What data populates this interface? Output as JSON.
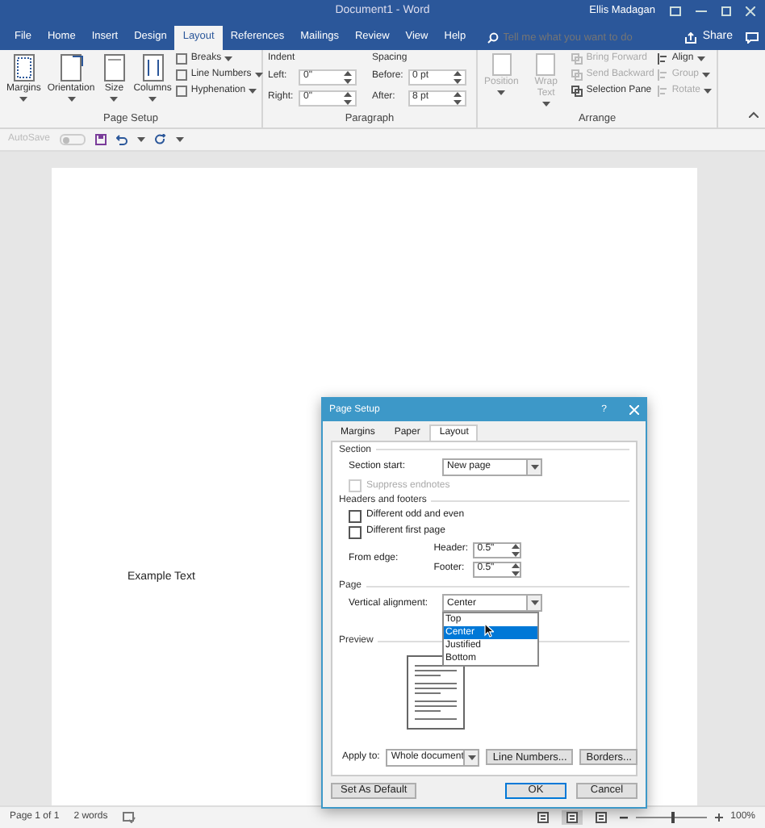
{
  "window": {
    "title": "Document1  -  Word",
    "user": "Ellis Madagan"
  },
  "tabs": [
    {
      "label": "File",
      "selected": false
    },
    {
      "label": "Home",
      "selected": false
    },
    {
      "label": "Insert",
      "selected": false
    },
    {
      "label": "Design",
      "selected": false
    },
    {
      "label": "Layout",
      "selected": true
    },
    {
      "label": "References",
      "selected": false
    },
    {
      "label": "Mailings",
      "selected": false
    },
    {
      "label": "Review",
      "selected": false
    },
    {
      "label": "View",
      "selected": false
    },
    {
      "label": "Help",
      "selected": false
    }
  ],
  "tell_me": {
    "placeholder": "Tell me what you want to do"
  },
  "share": "Share",
  "ribbon": {
    "page_setup": {
      "label": "Page Setup",
      "large_buttons": [
        {
          "label": "Margins"
        },
        {
          "label": "Orientation"
        },
        {
          "label": "Size"
        },
        {
          "label": "Columns"
        }
      ],
      "small_buttons": [
        {
          "label": "Breaks"
        },
        {
          "label": "Line Numbers"
        },
        {
          "label": "Hyphenation"
        }
      ]
    },
    "paragraph": {
      "label": "Paragraph",
      "indent_label": "Indent",
      "spacing_label": "Spacing",
      "indent": [
        {
          "label": "Left:",
          "value": "0\""
        },
        {
          "label": "Right:",
          "value": "0\""
        }
      ],
      "spacing": [
        {
          "label": "Before:",
          "value": "0 pt"
        },
        {
          "label": "After:",
          "value": "8 pt"
        }
      ]
    },
    "arrange": {
      "label": "Arrange",
      "large_buttons": [
        {
          "label": "Position",
          "disabled": true
        },
        {
          "label": "Wrap Text",
          "disabled": true
        }
      ],
      "items": [
        {
          "label": "Bring Forward",
          "disabled": true
        },
        {
          "label": "Send Backward",
          "disabled": true
        },
        {
          "label": "Selection Pane",
          "disabled": false
        }
      ],
      "align_items": [
        {
          "label": "Align",
          "disabled": false
        },
        {
          "label": "Group",
          "disabled": true
        },
        {
          "label": "Rotate",
          "disabled": true
        }
      ]
    }
  },
  "quick_access": {
    "autosave": "AutoSave",
    "autosave_on": false
  },
  "document": {
    "text": "Example Text"
  },
  "dialog": {
    "title": "Page Setup",
    "help": "?",
    "tabs": [
      {
        "label": "Margins",
        "selected": false
      },
      {
        "label": "Paper",
        "selected": false
      },
      {
        "label": "Layout",
        "selected": true
      }
    ],
    "section": {
      "heading": "Section",
      "start_label": "Section start:",
      "start_value": "New page",
      "suppress": {
        "label": "Suppress endnotes",
        "checked": false,
        "disabled": true
      }
    },
    "headers": {
      "heading": "Headers and footers",
      "checks": [
        {
          "label": "Different odd and even",
          "checked": false
        },
        {
          "label": "Different first page",
          "checked": false
        }
      ],
      "from_edge": "From edge:",
      "edges": [
        {
          "label": "Header:",
          "value": "0.5\""
        },
        {
          "label": "Footer:",
          "value": "0.5\""
        }
      ]
    },
    "page": {
      "heading": "Page",
      "align_label": "Vertical alignment:",
      "align_value": "Center",
      "options": [
        {
          "label": "Top",
          "selected": false
        },
        {
          "label": "Center",
          "selected": true
        },
        {
          "label": "Justified",
          "selected": false
        },
        {
          "label": "Bottom",
          "selected": false
        }
      ]
    },
    "preview": {
      "heading": "Preview"
    },
    "apply_label": "Apply to:",
    "apply_value": "Whole document",
    "buttons": [
      "Line Numbers...",
      "Borders..."
    ],
    "footer": {
      "default": "Set As Default",
      "ok": "OK",
      "cancel": "Cancel"
    }
  },
  "status_bar": {
    "page": "Page 1 of 1",
    "words": "2 words",
    "views": [
      {
        "selected": false
      },
      {
        "selected": true
      },
      {
        "selected": false
      }
    ],
    "zoom_slider": {
      "level": 0.5
    },
    "zoom": "100%"
  }
}
